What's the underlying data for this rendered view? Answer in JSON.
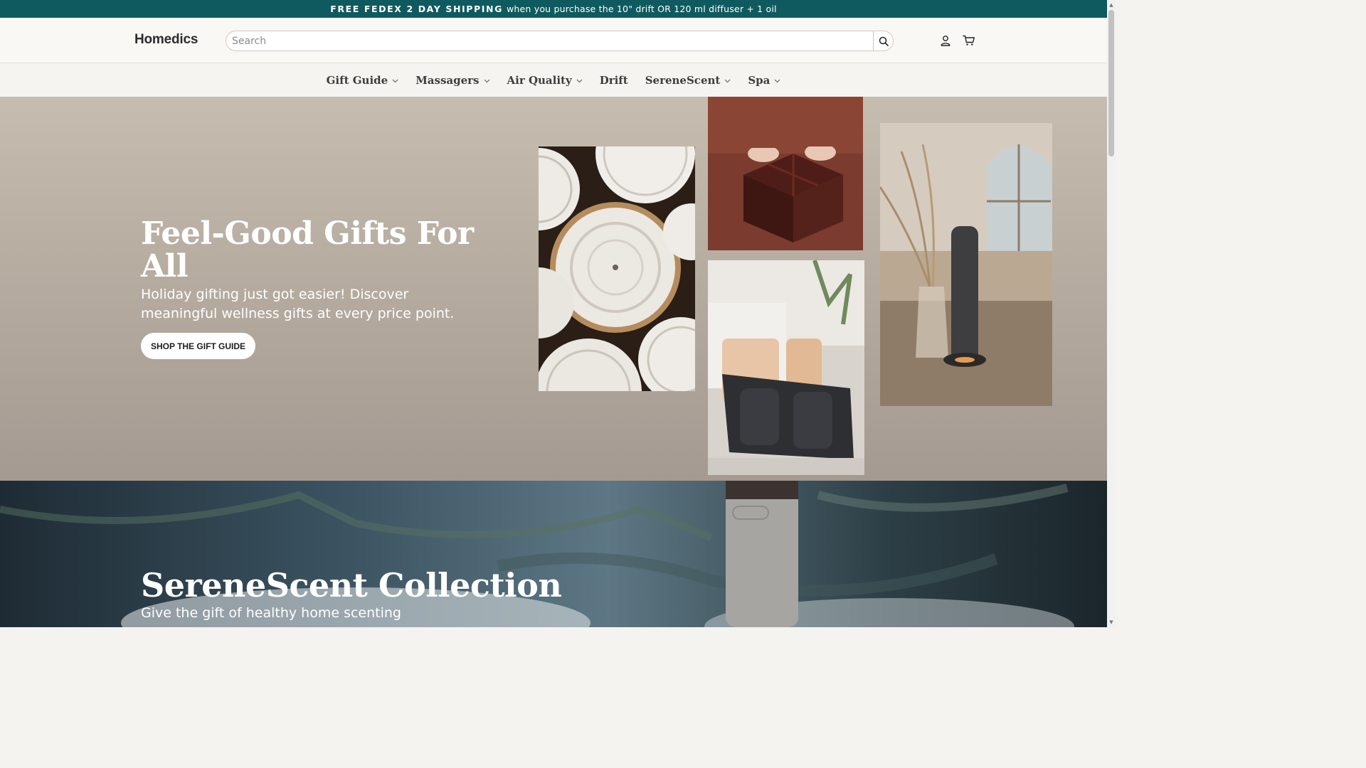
{
  "announcement": {
    "bold": "FREE FEDEX 2 DAY SHIPPING",
    "text": "when you purchase the 10\" drift OR 120 ml diffuser + 1 oil"
  },
  "header": {
    "logo": "Homedics",
    "search_placeholder": "Search",
    "search_icon": "search-icon",
    "account_icon": "user-icon",
    "cart_icon": "cart-icon"
  },
  "nav": {
    "items": [
      {
        "label": "Gift Guide",
        "dropdown": true
      },
      {
        "label": "Massagers",
        "dropdown": true
      },
      {
        "label": "Air Quality",
        "dropdown": true
      },
      {
        "label": "Drift",
        "dropdown": false
      },
      {
        "label": "SereneScent",
        "dropdown": true
      },
      {
        "label": "Spa",
        "dropdown": true
      }
    ]
  },
  "hero": {
    "title": "Feel-Good  Gifts For All",
    "subtitle": "Holiday gifting just got easier! Discover meaningful wellness gifts at every price point.",
    "cta": "SHOP THE GIFT GUIDE",
    "images": [
      "sand-art-plates-image",
      "gift-box-hands-image",
      "foot-massager-image",
      "diffuser-tower-image"
    ]
  },
  "serene": {
    "title": "SereneScent Collection",
    "subtitle": "Give the gift of healthy home scenting"
  },
  "colors": {
    "announcement_bg": "#0f5a5f",
    "hero_bg": "#b6aca0",
    "nav_bg": "#f6f4f0"
  }
}
